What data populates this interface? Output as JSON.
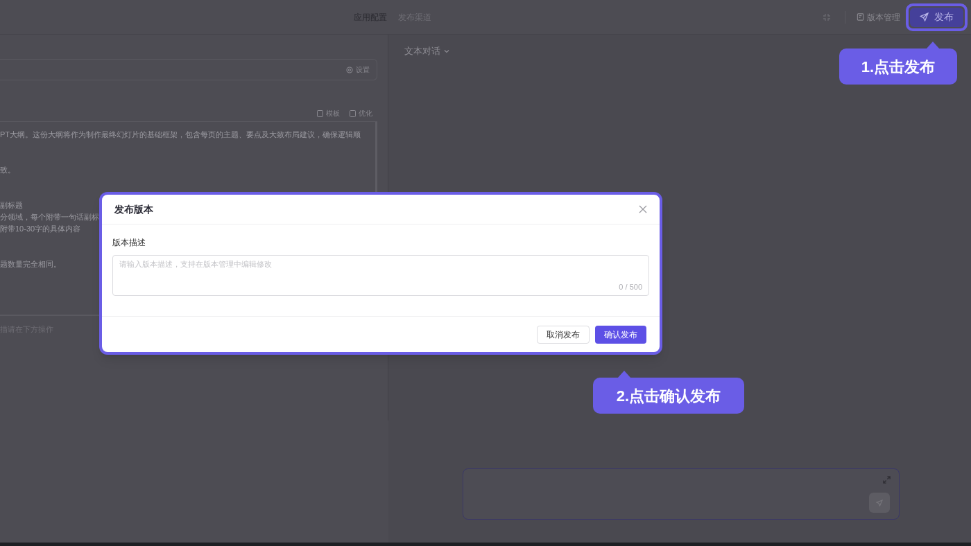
{
  "top_bar": {
    "tabs": [
      {
        "label": "应用配置",
        "selected": true
      },
      {
        "label": "发布渠道",
        "selected": false
      }
    ],
    "version_button": "版本管理",
    "publish_button": "发布"
  },
  "editor": {
    "settings_label": "设置",
    "actions": [
      "模板",
      "优化"
    ],
    "paragraphs": [
      [
        "PT大纲。这份大纲将作为制作最终幻灯片的基础框架，包含每页的主题、要点及大致布局建议，确保逻辑顺"
      ],
      [
        "致。"
      ],
      [
        "副标题",
        "分领域，每个附带一句话副标",
        "附带10-30字的具体内容"
      ],
      [
        "题数量完全相同。"
      ]
    ],
    "hint": "描请在下方操作"
  },
  "chat": {
    "mode": "文本对话"
  },
  "dialog": {
    "title": "发布版本",
    "field_label": "版本描述",
    "placeholder": "请输入版本描述，支持在版本管理中编辑修改",
    "counter": "0 / 500",
    "buttons": [
      {
        "label": "取消发布",
        "kind": "secondary"
      },
      {
        "label": "确认发布",
        "kind": "primary"
      }
    ]
  },
  "callouts": [
    {
      "text": "1.点击发布"
    },
    {
      "text": "2.点击确认发布"
    }
  ]
}
